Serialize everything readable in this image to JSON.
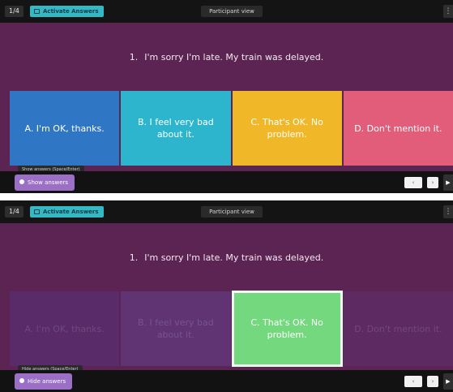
{
  "panels": [
    {
      "slide_counter": "1/4",
      "audience_button": "Activate Answers",
      "participant_view": "Participant view",
      "menu_icon": "ellipsis-icon",
      "question_number": "1.",
      "question_text": "I'm sorry I'm late. My train was delayed.",
      "answers": [
        "A. I'm OK, thanks.",
        "B. I feel very bad about it.",
        "C. That's OK. No problem.",
        "D. Don't mention it."
      ],
      "tooltip": "Show answers (Space/Enter)",
      "toggle_label": "Show answers",
      "play_icon": "play-icon"
    },
    {
      "slide_counter": "1/4",
      "audience_button": "Activate Answers",
      "participant_view": "Participant view",
      "menu_icon": "ellipsis-icon",
      "question_number": "1.",
      "question_text": "I'm sorry I'm late. My train was delayed.",
      "answers": [
        "A. I'm OK, thanks.",
        "B. I feel very bad about it.",
        "C. That's OK. No problem.",
        "D. Don't mention it."
      ],
      "correct_answer": "C",
      "tooltip": "Hide answers (Space/Enter)",
      "toggle_label": "Hide answers",
      "play_icon": "play-icon"
    }
  ],
  "colors": {
    "background": "#5b2452",
    "answer_a": "#2f77c4",
    "answer_b": "#2cb5cc",
    "answer_c": "#f0b829",
    "answer_d": "#e25d79",
    "correct_highlight": "#74d97e",
    "toggle_button": "#9b6fc6"
  }
}
